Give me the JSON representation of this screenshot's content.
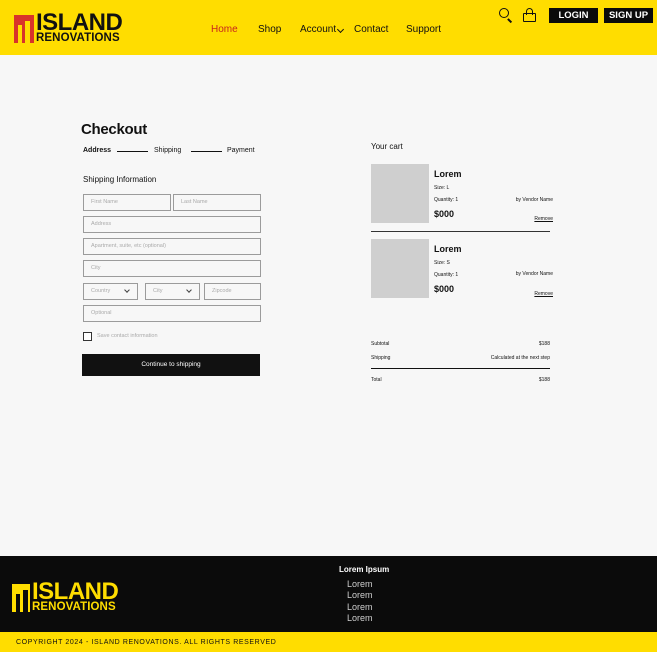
{
  "brand": {
    "logo_line1": "ISLAND",
    "logo_line2": "RENOVATIONS",
    "primary_color": "#ffdd00",
    "accent_color": "#c8251c",
    "dark_color": "#0b0b0b"
  },
  "header": {
    "nav": [
      {
        "label": "Home",
        "active": true
      },
      {
        "label": "Shop"
      },
      {
        "label": "Account"
      },
      {
        "label": "Contact"
      },
      {
        "label": "Support"
      }
    ],
    "icons": [
      "search-icon",
      "bag-icon",
      "chevron-down-icon"
    ],
    "login_label": "LOGIN",
    "signup_label": "SIGN UP"
  },
  "checkout": {
    "title": "Checkout",
    "steps": [
      "Address",
      "Shipping",
      "Payment"
    ],
    "section_label": "Shipping Information",
    "placeholders": {
      "first_name": "First Name",
      "last_name": "Last Name",
      "address": "Address",
      "apartment": "Apartment, suite, etc (optional)",
      "city": "City",
      "country": "Country",
      "city_select": "City",
      "zipcode": "Zipcode",
      "optional": "Optional"
    },
    "save_contact_label": "Save contact information",
    "continue_label": "Continue to shipping"
  },
  "cart": {
    "title": "Your cart",
    "items": [
      {
        "name": "Lorem",
        "size": "Size: L",
        "quantity": "Quantity: 1",
        "price": "$000",
        "vendor": "by Vendor Name",
        "remove": "Remove"
      },
      {
        "name": "Lorem",
        "size": "Size: S",
        "quantity": "Quantity: 1",
        "price": "$000",
        "vendor": "by Vendor Name",
        "remove": "Remove"
      }
    ],
    "subtotal_label": "Subtotal",
    "subtotal_value": "$188",
    "shipping_label": "Shipping",
    "shipping_value": "Calculated at the next step",
    "total_label": "Total",
    "total_value": "$188"
  },
  "footer": {
    "heading": "Lorem Ipsum",
    "links": [
      "Lorem",
      "Lorem",
      "Lorem",
      "Lorem"
    ],
    "copyright": "COPYRIGHT 2024 - ISLAND RENOVATIONS. ALL RIGHTS RESERVED"
  }
}
